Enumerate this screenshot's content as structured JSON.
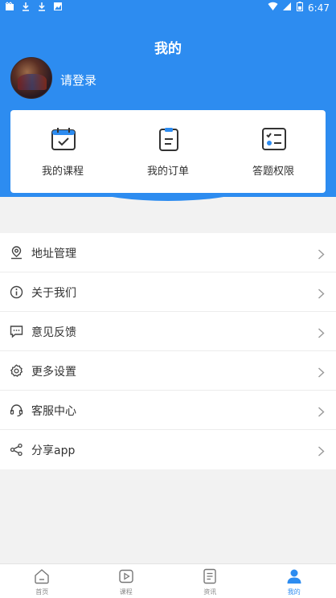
{
  "status_bar": {
    "time": "6:47"
  },
  "header": {
    "title": "我的",
    "login_prompt": "请登录"
  },
  "quick_actions": [
    {
      "label": "我的课程",
      "icon": "calendar-icon"
    },
    {
      "label": "我的订单",
      "icon": "clipboard-icon"
    },
    {
      "label": "答题权限",
      "icon": "checklist-icon"
    }
  ],
  "menu": [
    {
      "label": "地址管理",
      "icon": "location-pin-icon"
    },
    {
      "label": "关于我们",
      "icon": "info-icon"
    },
    {
      "label": "意见反馈",
      "icon": "chat-icon"
    },
    {
      "label": "更多设置",
      "icon": "gear-icon"
    },
    {
      "label": "客服中心",
      "icon": "headset-icon"
    },
    {
      "label": "分享app",
      "icon": "share-icon"
    }
  ],
  "tabs": [
    {
      "label": "首页",
      "icon": "home-icon",
      "active": false
    },
    {
      "label": "课程",
      "icon": "play-icon",
      "active": false
    },
    {
      "label": "资讯",
      "icon": "document-icon",
      "active": false
    },
    {
      "label": "我的",
      "icon": "person-icon",
      "active": true
    }
  ],
  "colors": {
    "accent": "#2d8cf0",
    "background": "#f2f2f2"
  }
}
